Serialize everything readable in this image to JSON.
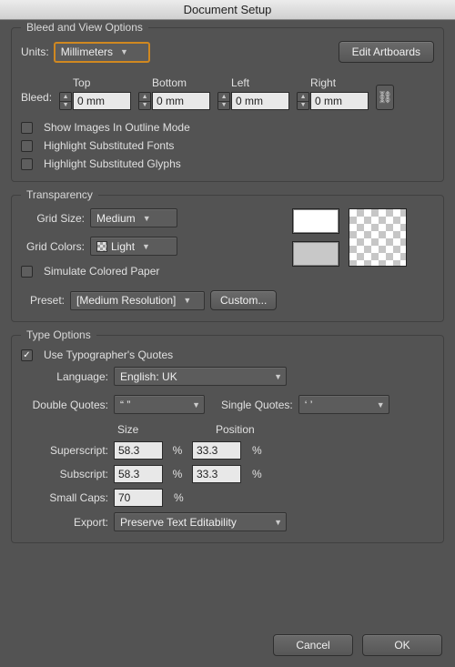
{
  "title": "Document Setup",
  "bleed_view": {
    "legend": "Bleed and View Options",
    "units_label": "Units:",
    "units_value": "Millimeters",
    "edit_artboards": "Edit Artboards",
    "bleed_label": "Bleed:",
    "cols": {
      "top": "Top",
      "bottom": "Bottom",
      "left": "Left",
      "right": "Right"
    },
    "vals": {
      "top": "0 mm",
      "bottom": "0 mm",
      "left": "0 mm",
      "right": "0 mm"
    },
    "show_images": "Show Images In Outline Mode",
    "hl_fonts": "Highlight Substituted Fonts",
    "hl_glyphs": "Highlight Substituted Glyphs"
  },
  "transparency": {
    "legend": "Transparency",
    "grid_size_label": "Grid Size:",
    "grid_size_value": "Medium",
    "grid_colors_label": "Grid Colors:",
    "grid_colors_value": "Light",
    "simulate": "Simulate Colored Paper",
    "preset_label": "Preset:",
    "preset_value": "[Medium Resolution]",
    "custom": "Custom..."
  },
  "type_options": {
    "legend": "Type Options",
    "use_typographers": "Use Typographer's Quotes",
    "language_label": "Language:",
    "language_value": "English: UK",
    "double_quotes_label": "Double Quotes:",
    "double_quotes_value": "“ ”",
    "single_quotes_label": "Single Quotes:",
    "single_quotes_value": "‘ ’",
    "size_header": "Size",
    "position_header": "Position",
    "superscript_label": "Superscript:",
    "superscript_size": "58.3",
    "superscript_pos": "33.3",
    "subscript_label": "Subscript:",
    "subscript_size": "58.3",
    "subscript_pos": "33.3",
    "smallcaps_label": "Small Caps:",
    "smallcaps_val": "70",
    "export_label": "Export:",
    "export_value": "Preserve Text Editability",
    "pct": "%"
  },
  "footer": {
    "cancel": "Cancel",
    "ok": "OK"
  }
}
